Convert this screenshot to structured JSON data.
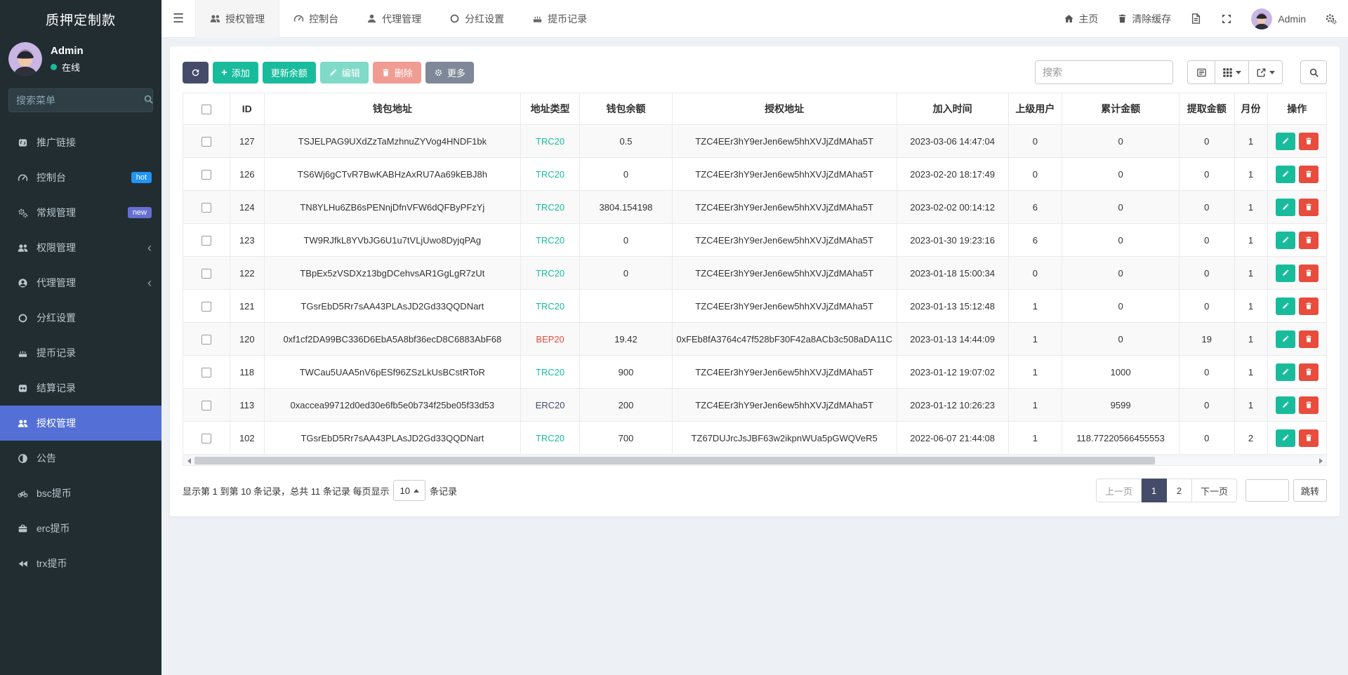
{
  "brand": {
    "title": "质押定制款"
  },
  "sidebar": {
    "user": {
      "name": "Admin",
      "status": "在线"
    },
    "search_placeholder": "搜索菜单",
    "active_color": "#5470d6",
    "badge_colors": {
      "hot": "#2095f2",
      "new": "#666fd1"
    },
    "items": [
      {
        "label": "推广链接",
        "icon": "link-icon"
      },
      {
        "label": "控制台",
        "icon": "dashboard-icon",
        "badge": "hot"
      },
      {
        "label": "常规管理",
        "icon": "gears-icon",
        "badge": "new"
      },
      {
        "label": "权限管理",
        "icon": "users-icon",
        "chevron": "‹"
      },
      {
        "label": "代理管理",
        "icon": "user-circle-icon",
        "chevron": "‹"
      },
      {
        "label": "分红设置",
        "icon": "circle-o-icon"
      },
      {
        "label": "提币记录",
        "icon": "cake-icon"
      },
      {
        "label": "结算记录",
        "icon": "cs-icon"
      },
      {
        "label": "授权管理",
        "icon": "users-icon",
        "active": true
      },
      {
        "label": "公告",
        "icon": "adjust-icon"
      },
      {
        "label": "bsc提币",
        "icon": "bicycle-icon"
      },
      {
        "label": "erc提币",
        "icon": "briefcase-icon"
      },
      {
        "label": "trx提币",
        "icon": "backward-icon"
      }
    ]
  },
  "topnav": {
    "tabs": [
      {
        "label": "授权管理",
        "active": true
      },
      {
        "label": "控制台"
      },
      {
        "label": "代理管理"
      },
      {
        "label": "分红设置"
      },
      {
        "label": "提币记录"
      }
    ],
    "right": {
      "home": "主页",
      "clear_cache": "清除缓存",
      "username": "Admin"
    }
  },
  "toolbar": {
    "add": "添加",
    "update_balance": "更新余额",
    "edit": "编辑",
    "delete": "删除",
    "more": "更多",
    "search_placeholder": "搜索"
  },
  "table": {
    "columns": [
      "ID",
      "钱包地址",
      "地址类型",
      "钱包余额",
      "授权地址",
      "加入时间",
      "上级用户",
      "累计金额",
      "提取金额",
      "月份",
      "操作"
    ],
    "type_colors": {
      "TRC20": "#18bc9c",
      "BEP20": "#e74c3c",
      "ERC20": "#444c69"
    },
    "rows": [
      {
        "id": "127",
        "wallet": "TSJELPAG9UXdZzTaMzhnuZYVog4HNDF1bk",
        "type": "TRC20",
        "balance": "0.5",
        "auth": "TZC4EEr3hY9erJen6ew5hhXVJjZdMAha5T",
        "joined": "2023-03-06 14:47:04",
        "parent": "0",
        "total": "0",
        "withdrawn": "0",
        "month": "1"
      },
      {
        "id": "126",
        "wallet": "TS6Wj6gCTvR7BwKABHzAxRU7Aa69kEBJ8h",
        "type": "TRC20",
        "balance": "0",
        "auth": "TZC4EEr3hY9erJen6ew5hhXVJjZdMAha5T",
        "joined": "2023-02-20 18:17:49",
        "parent": "0",
        "total": "0",
        "withdrawn": "0",
        "month": "1"
      },
      {
        "id": "124",
        "wallet": "TN8YLHu6ZB6sPENnjDfnVFW6dQFByPFzYj",
        "type": "TRC20",
        "balance": "3804.154198",
        "auth": "TZC4EEr3hY9erJen6ew5hhXVJjZdMAha5T",
        "joined": "2023-02-02 00:14:12",
        "parent": "6",
        "total": "0",
        "withdrawn": "0",
        "month": "1"
      },
      {
        "id": "123",
        "wallet": "TW9RJfkL8YVbJG6U1u7tVLjUwo8DyjqPAg",
        "type": "TRC20",
        "balance": "0",
        "auth": "TZC4EEr3hY9erJen6ew5hhXVJjZdMAha5T",
        "joined": "2023-01-30 19:23:16",
        "parent": "6",
        "total": "0",
        "withdrawn": "0",
        "month": "1"
      },
      {
        "id": "122",
        "wallet": "TBpEx5zVSDXz13bgDCehvsAR1GgLgR7zUt",
        "type": "TRC20",
        "balance": "0",
        "auth": "TZC4EEr3hY9erJen6ew5hhXVJjZdMAha5T",
        "joined": "2023-01-18 15:00:34",
        "parent": "0",
        "total": "0",
        "withdrawn": "0",
        "month": "1"
      },
      {
        "id": "121",
        "wallet": "TGsrEbD5Rr7sAA43PLAsJD2Gd33QQDNart",
        "type": "TRC20",
        "balance": "",
        "auth": "TZC4EEr3hY9erJen6ew5hhXVJjZdMAha5T",
        "joined": "2023-01-13 15:12:48",
        "parent": "1",
        "total": "0",
        "withdrawn": "0",
        "month": "1"
      },
      {
        "id": "120",
        "wallet": "0xf1cf2DA99BC336D6EbA5A8bf36ecD8C6883AbF68",
        "type": "BEP20",
        "balance": "19.42",
        "auth": "0xFEb8fA3764c47f528bF30F42a8ACb3c508aDA11C",
        "joined": "2023-01-13 14:44:09",
        "parent": "1",
        "total": "0",
        "withdrawn": "19",
        "month": "1"
      },
      {
        "id": "118",
        "wallet": "TWCau5UAA5nV6pESf96ZSzLkUsBCstRToR",
        "type": "TRC20",
        "balance": "900",
        "auth": "TZC4EEr3hY9erJen6ew5hhXVJjZdMAha5T",
        "joined": "2023-01-12 19:07:02",
        "parent": "1",
        "total": "1000",
        "withdrawn": "0",
        "month": "1"
      },
      {
        "id": "113",
        "wallet": "0xaccea99712d0ed30e6fb5e0b734f25be05f33d53",
        "type": "ERC20",
        "balance": "200",
        "auth": "TZC4EEr3hY9erJen6ew5hhXVJjZdMAha5T",
        "joined": "2023-01-12 10:26:23",
        "parent": "1",
        "total": "9599",
        "withdrawn": "0",
        "month": "1"
      },
      {
        "id": "102",
        "wallet": "TGsrEbD5Rr7sAA43PLAsJD2Gd33QQDNart",
        "type": "TRC20",
        "balance": "700",
        "auth": "TZ67DUJrcJsJBF63w2ikpnWUa5pGWQVeR5",
        "joined": "2022-06-07 21:44:08",
        "parent": "1",
        "total": "118.77220566455553",
        "withdrawn": "0",
        "month": "2"
      }
    ]
  },
  "footer": {
    "info_before": "显示第 1 到第 10 条记录，总共 11 条记录 每页显示",
    "page_size": "10",
    "info_after": "条记录",
    "prev": "上一页",
    "pages": [
      "1",
      "2"
    ],
    "active_page": "1",
    "next": "下一页",
    "jump": "跳转"
  }
}
